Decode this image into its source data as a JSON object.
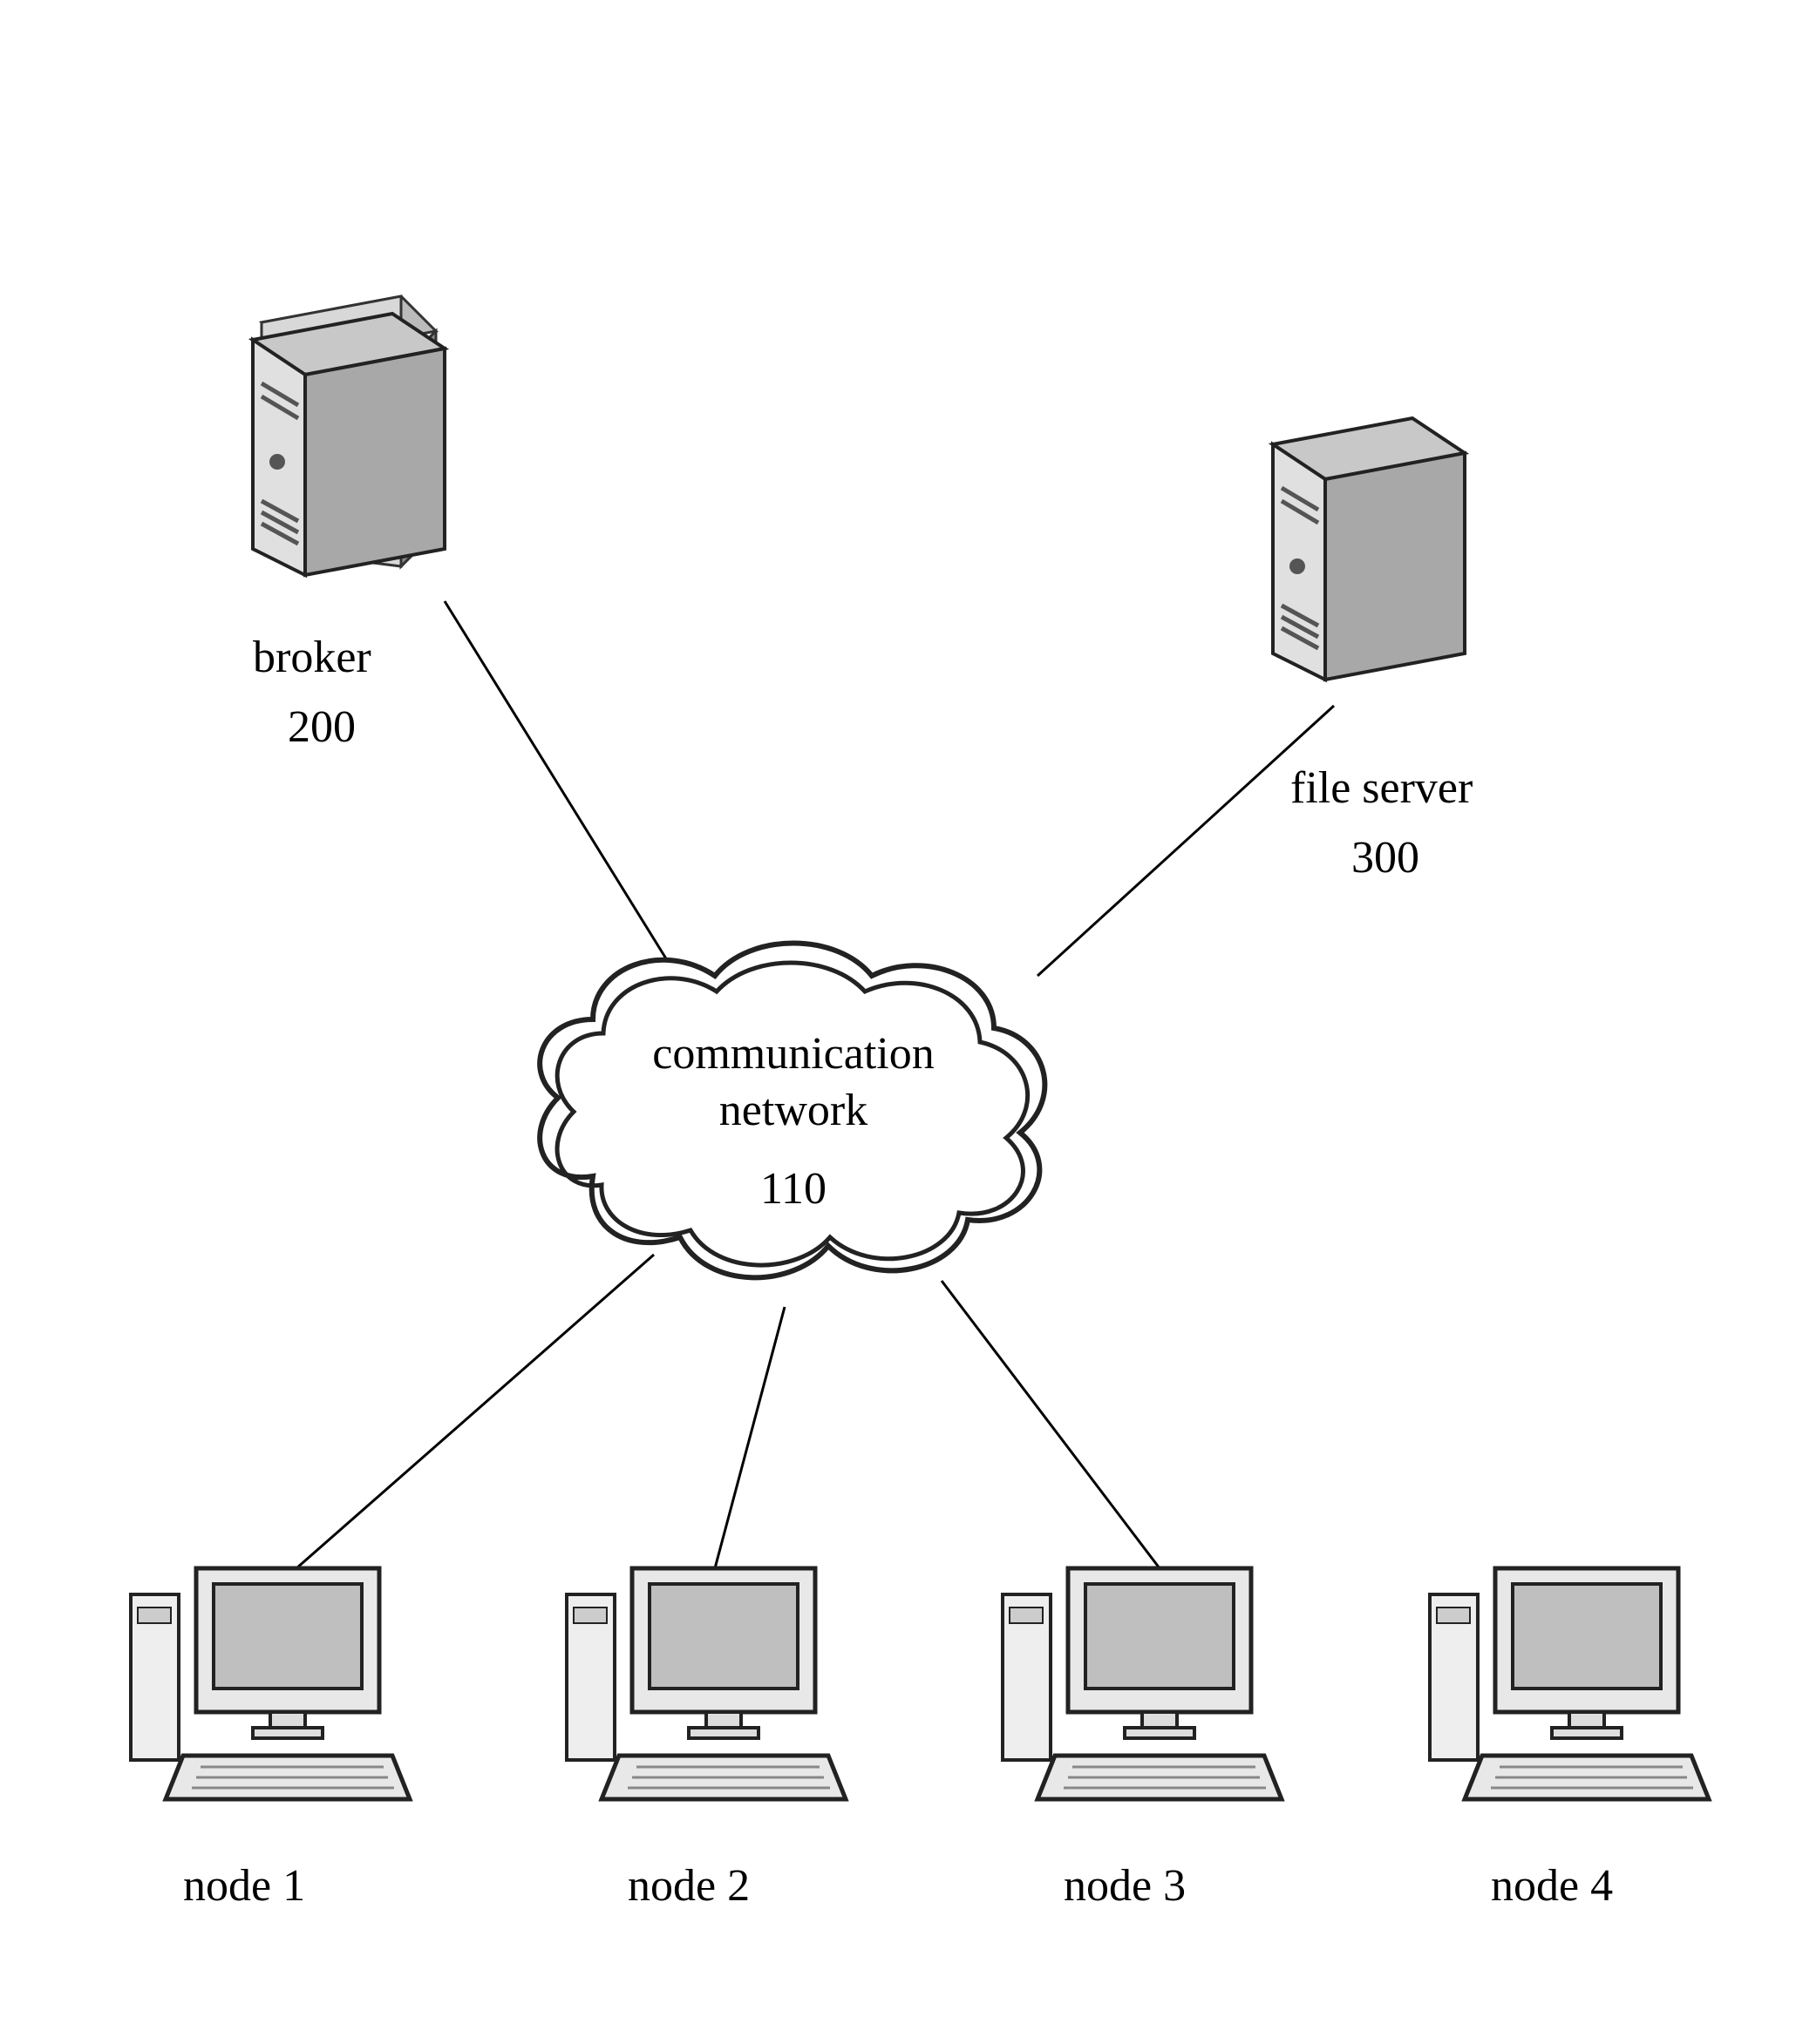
{
  "broker": {
    "label": "broker",
    "ref": "200"
  },
  "file_server": {
    "label": "file server",
    "ref": "300"
  },
  "cloud": {
    "label_line1": "communication",
    "label_line2": "network",
    "ref": "110"
  },
  "nodes": [
    {
      "label": "node 1"
    },
    {
      "label": "node 2"
    },
    {
      "label": "node 3"
    },
    {
      "label": "node 4"
    }
  ]
}
